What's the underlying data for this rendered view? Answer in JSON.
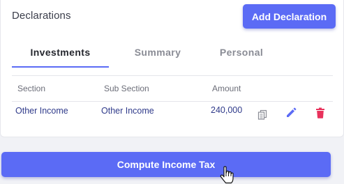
{
  "declarations": {
    "title": "Declarations",
    "add_button_label": "Add Declaration"
  },
  "tabs": [
    {
      "label": "Investments",
      "active": true
    },
    {
      "label": "Summary",
      "active": false
    },
    {
      "label": "Personal",
      "active": false
    }
  ],
  "table": {
    "headers": [
      "Section",
      "Sub Section",
      "Amount"
    ],
    "rows": [
      {
        "section": "Other Income",
        "sub_section": "Other Income",
        "amount": "240,000",
        "actions": [
          "copy-icon",
          "edit-icon",
          "delete-icon"
        ]
      }
    ]
  },
  "compute_button_label": "Compute Income Tax",
  "colors": {
    "accent": "#5b6bf5",
    "delete": "#e8315b",
    "copy": "#8a8c95"
  }
}
